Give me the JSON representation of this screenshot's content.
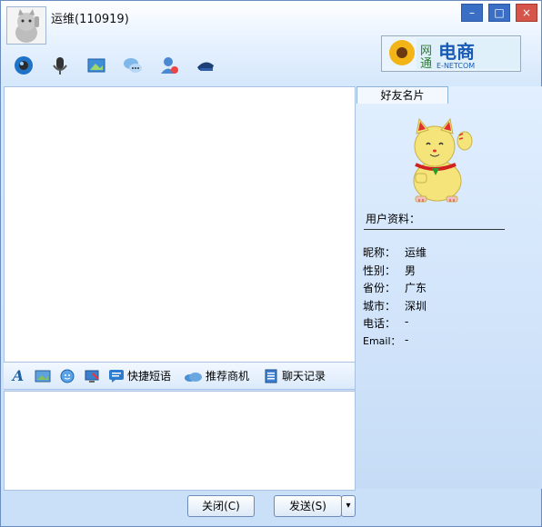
{
  "window": {
    "title": "运维(110919)",
    "controls": [
      "–",
      "□",
      "×"
    ]
  },
  "logo": {
    "text_cn": "网通电商",
    "text_en": "E-NETCOM"
  },
  "toolbar": {
    "icons": [
      "video-call-icon",
      "voice-call-icon",
      "send-image-icon",
      "chat-group-icon",
      "contacts-icon",
      "hat-icon"
    ]
  },
  "format_bar": {
    "font_label": "A",
    "quick_phrases": "快捷短语",
    "recommend": "推荐商机",
    "history": "聊天记录"
  },
  "panel": {
    "tab": "好友名片",
    "profile_title": "用户资料：",
    "fields": [
      {
        "key": "昵称：",
        "value": "运维"
      },
      {
        "key": "性别：",
        "value": "男"
      },
      {
        "key": "省份：",
        "value": "广东"
      },
      {
        "key": "城市：",
        "value": "深圳"
      },
      {
        "key": "电话：",
        "value": "-"
      },
      {
        "key": "Email：",
        "value": "-"
      }
    ]
  },
  "buttons": {
    "close": "关闭(C)",
    "send": "发送(S)",
    "send_dropdown": "▾"
  },
  "colors": {
    "title_bar_btn": "#3b6fc6",
    "close_btn": "#d6554a",
    "cat_body": "#f4e47a",
    "panel_bg": "#d6e8fb"
  }
}
